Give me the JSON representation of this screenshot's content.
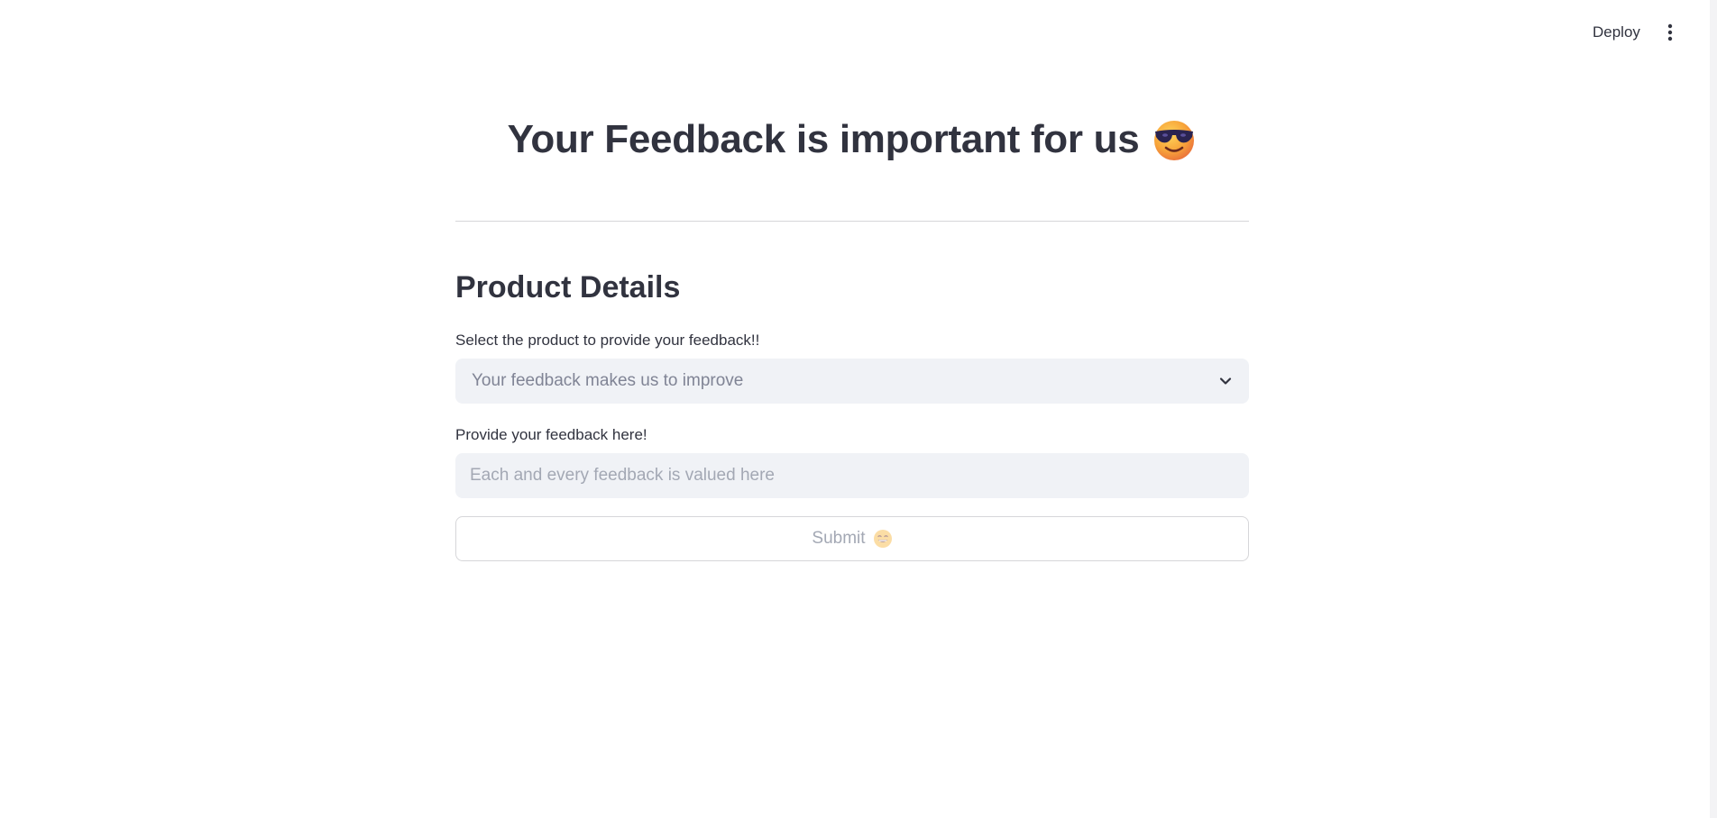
{
  "toolbar": {
    "deploy_label": "Deploy",
    "menu_icon": "more-vertical-icon"
  },
  "main": {
    "title": "Your Feedback is important for us",
    "title_icon": "smiling-face-with-sunglasses-icon",
    "section_heading": "Product Details",
    "product_select": {
      "label": "Select the product to provide your feedback!!",
      "placeholder": "Your feedback makes us to improve",
      "icon": "chevron-down-icon"
    },
    "feedback_input": {
      "label": "Provide your feedback here!",
      "placeholder": "Each and every feedback is valued here",
      "value": ""
    },
    "submit_button": {
      "label": "Submit",
      "icon": "grinning-face-icon",
      "disabled": true
    }
  },
  "colors": {
    "text": "#31333f",
    "input_bg": "#f0f2f6",
    "placeholder": "#808495",
    "muted": "#a3a8b4",
    "border": "#d6d6d9"
  }
}
